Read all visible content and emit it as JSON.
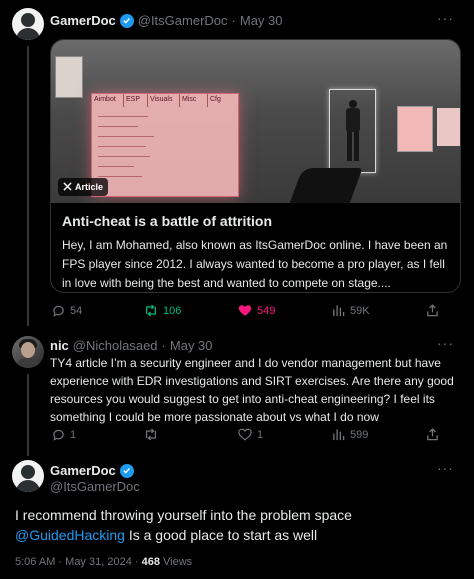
{
  "tweet1": {
    "name": "GamerDoc",
    "handle": "@ItsGamerDoc",
    "separator": "·",
    "date": "May 30",
    "card": {
      "badge": "Article",
      "title": "Anti-cheat is a battle of attrition",
      "description": "Hey, I am Mohamed, also known as ItsGamerDoc online. I have been an FPS player since 2012. I always wanted to become a pro player, as I fell in love with being the best and wanted to compete on stage....",
      "menu_tabs": [
        "Aimbot",
        "ESP",
        "Visuals",
        "Misc",
        "Cfg"
      ]
    },
    "actions": {
      "replies": "54",
      "reposts": "106",
      "likes": "549",
      "views": "59K"
    }
  },
  "tweet2": {
    "name": "nic",
    "handle": "@Nicholasaed",
    "separator": "·",
    "date": "May 30",
    "text": "TY4 article I’m a security engineer and I do vendor management but have experience with EDR investigations and SIRT exercises. Are there any good resources you would suggest to get into anti-cheat engineering? I feel its something I could be more passionate about vs what I do now",
    "actions": {
      "replies": "1",
      "reposts": "",
      "likes": "1",
      "views": "599"
    }
  },
  "tweet3": {
    "name": "GamerDoc",
    "handle": "@ItsGamerDoc",
    "text_before": "I recommend throwing yourself into the problem space ",
    "mention": "@GuidedHacking",
    "text_after": " Is a good place to start as well",
    "time": "5:06 AM",
    "separator": "·",
    "date": "May 31, 2024",
    "views_count": "468",
    "views_label": "Views"
  },
  "colors": {
    "accent": "#1d9bf0",
    "repost_active": "#00ba7c",
    "like_active": "#f91880",
    "muted": "#71767b"
  }
}
